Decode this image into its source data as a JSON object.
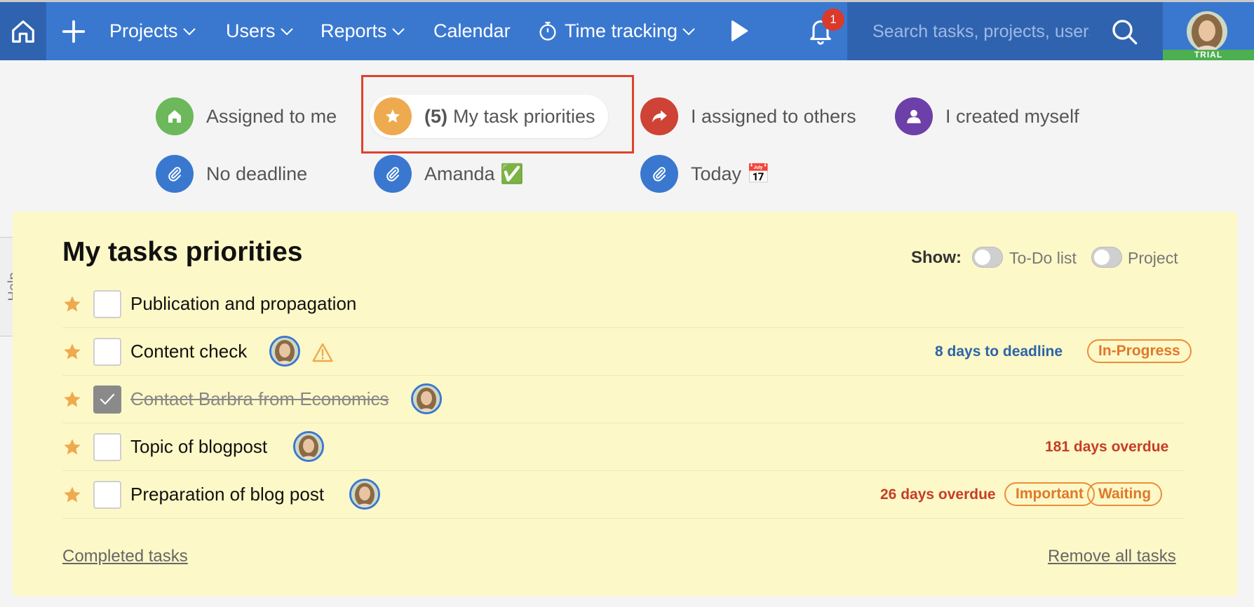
{
  "nav": {
    "projects": "Projects",
    "users": "Users",
    "reports": "Reports",
    "calendar": "Calendar",
    "time_tracking": "Time tracking",
    "notifications_count": "1",
    "search_placeholder": "Search tasks, projects, users",
    "trial_badge": "TRIAL"
  },
  "filters": [
    {
      "label": "Assigned to me",
      "icon": "home-icon",
      "color": "#6cb85a"
    },
    {
      "count": "(5)",
      "label": "My task priorities",
      "icon": "star-icon",
      "color": "#eeaa4e",
      "active": true
    },
    {
      "label": "I assigned to others",
      "icon": "share-arrow-icon",
      "color": "#cf4236"
    },
    {
      "label": "I created myself",
      "icon": "person-icon",
      "color": "#6d3fa8"
    },
    {
      "label": "No deadline",
      "icon": "paperclip-icon",
      "color": "#3a78d0"
    },
    {
      "label": "Amanda ✅",
      "icon": "paperclip-icon",
      "color": "#3a78d0"
    },
    {
      "label": "Today 📅",
      "icon": "paperclip-icon",
      "color": "#3a78d0"
    }
  ],
  "help_label": "Help",
  "panel": {
    "title": "My tasks priorities",
    "show_label": "Show:",
    "toggle_todo": "To-Do list",
    "toggle_project": "Project",
    "completed_link": "Completed tasks",
    "remove_link": "Remove all tasks"
  },
  "tasks": [
    {
      "title": "Publication and propagation",
      "done": false
    },
    {
      "title": "Content check",
      "done": false,
      "deadline": "8 days to deadline",
      "deadline_color": "#2c64a8",
      "tags": [
        "In-Progress"
      ],
      "warning": true
    },
    {
      "title": "Contact Barbra from Economics",
      "done": true
    },
    {
      "title": "Topic of blogpost",
      "done": false,
      "deadline": "181 days overdue",
      "deadline_color": "#c63d27"
    },
    {
      "title": "Preparation of blog post",
      "done": false,
      "deadline": "26 days overdue",
      "deadline_color": "#c63d27",
      "tags": [
        "Important",
        "Waiting"
      ]
    }
  ],
  "colors": {
    "nav_bg": "#3a78d0",
    "panel_bg": "#fdf8c7",
    "tag_orange": "#ec8d3c",
    "star": "#eeaa4e"
  }
}
